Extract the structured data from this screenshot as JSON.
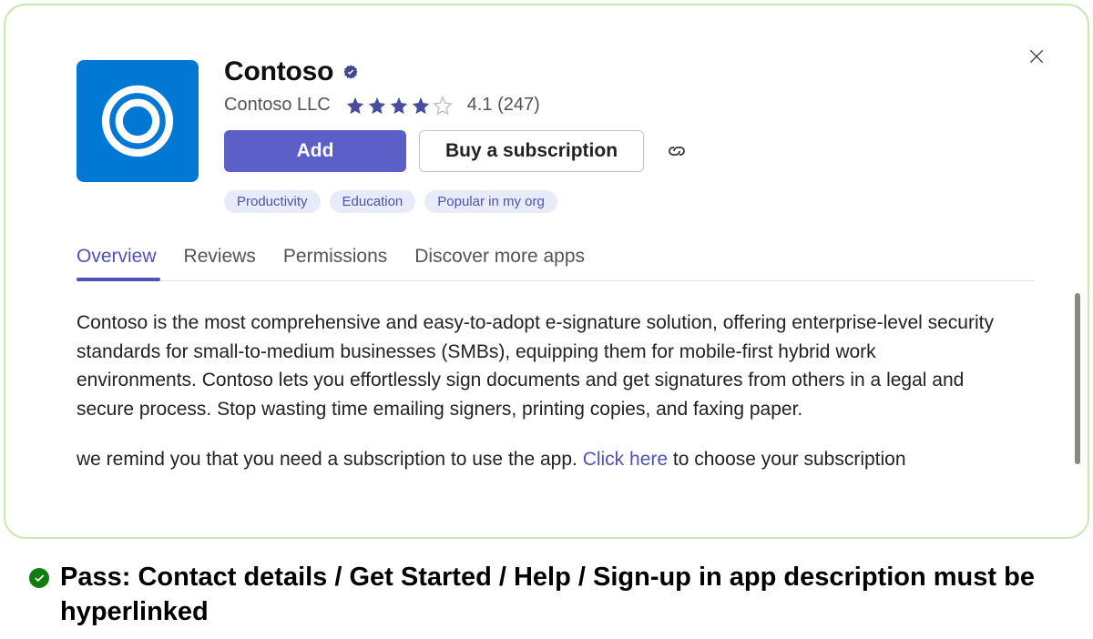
{
  "app": {
    "name": "Contoso",
    "publisher": "Contoso LLC",
    "rating_value": "4.1",
    "rating_count": "(247)",
    "stars_filled": 4,
    "stars_total": 5
  },
  "actions": {
    "add": "Add",
    "buy": "Buy a subscription"
  },
  "tags": [
    "Productivity",
    "Education",
    "Popular in my org"
  ],
  "tabs": [
    "Overview",
    "Reviews",
    "Permissions",
    "Discover more apps"
  ],
  "active_tab": "Overview",
  "description": {
    "p1": "Contoso is the most comprehensive and easy-to-adopt e-signature solution, offering enterprise-level security standards for small-to-medium businesses (SMBs), equipping them for mobile-first hybrid work environments. Contoso lets you effortlessly sign documents and get signatures from others in a legal and secure process. Stop wasting time emailing signers, printing copies, and faxing paper.",
    "p2_pre": "we remind you that  you need a subscription to use the app. ",
    "p2_link": "Click here",
    "p2_post": " to choose your subscription"
  },
  "pass": {
    "text": "Pass: Contact details / Get Started / Help / Sign-up in app description must be hyperlinked"
  }
}
